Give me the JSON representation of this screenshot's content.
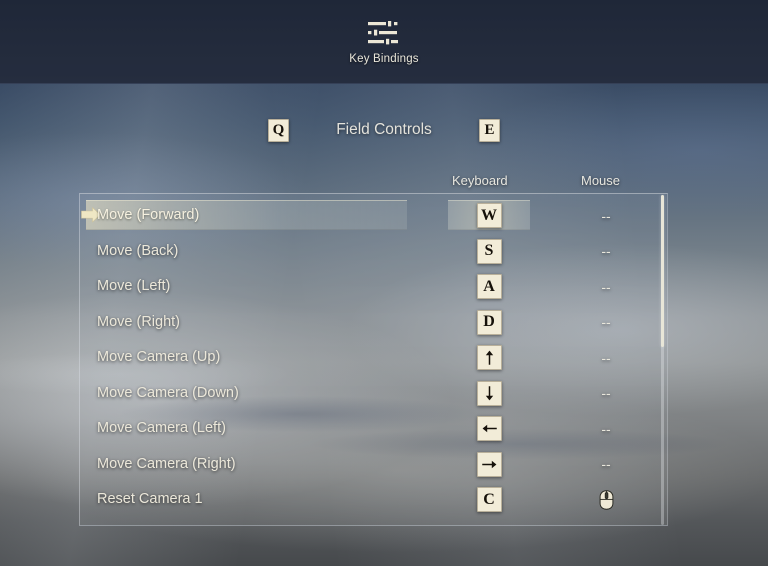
{
  "topbar": {
    "icon": "sliders-icon",
    "title": "Key Bindings"
  },
  "section": {
    "prev_key": "Q",
    "title": "Field Controls",
    "next_key": "E"
  },
  "columns": {
    "action": "",
    "keyboard": "Keyboard",
    "mouse": "Mouse"
  },
  "empty_binding": "--",
  "selected_index": 0,
  "selection_arrow_icon": "arrow-right-pointer-icon",
  "scrollbar": {
    "thumb_top_pct": 0,
    "thumb_height_pct": 46
  },
  "rows": [
    {
      "action": "Move (Forward)",
      "keyboard": "W",
      "keyboard_icon": "",
      "mouse": "--",
      "mouse_icon": "",
      "selected": true
    },
    {
      "action": "Move (Back)",
      "keyboard": "S",
      "keyboard_icon": "",
      "mouse": "--",
      "mouse_icon": "",
      "selected": false
    },
    {
      "action": "Move (Left)",
      "keyboard": "A",
      "keyboard_icon": "",
      "mouse": "--",
      "mouse_icon": "",
      "selected": false
    },
    {
      "action": "Move (Right)",
      "keyboard": "D",
      "keyboard_icon": "",
      "mouse": "--",
      "mouse_icon": "",
      "selected": false
    },
    {
      "action": "Move Camera (Up)",
      "keyboard": "",
      "keyboard_icon": "arrow-up-key-icon",
      "mouse": "--",
      "mouse_icon": "",
      "selected": false
    },
    {
      "action": "Move Camera (Down)",
      "keyboard": "",
      "keyboard_icon": "arrow-down-key-icon",
      "mouse": "--",
      "mouse_icon": "",
      "selected": false
    },
    {
      "action": "Move Camera (Left)",
      "keyboard": "",
      "keyboard_icon": "arrow-left-key-icon",
      "mouse": "--",
      "mouse_icon": "",
      "selected": false
    },
    {
      "action": "Move Camera (Right)",
      "keyboard": "",
      "keyboard_icon": "arrow-right-key-icon",
      "mouse": "--",
      "mouse_icon": "",
      "selected": false
    },
    {
      "action": "Reset Camera 1",
      "keyboard": "C",
      "keyboard_icon": "",
      "mouse": "",
      "mouse_icon": "mouse-icon",
      "selected": false
    }
  ],
  "colors": {
    "keycap_bg": "#f2ecd8",
    "keycap_fg": "#16110a",
    "text": "#ece8da",
    "topbar_bg": "#232b3c",
    "highlight": "#e9e2c4"
  }
}
